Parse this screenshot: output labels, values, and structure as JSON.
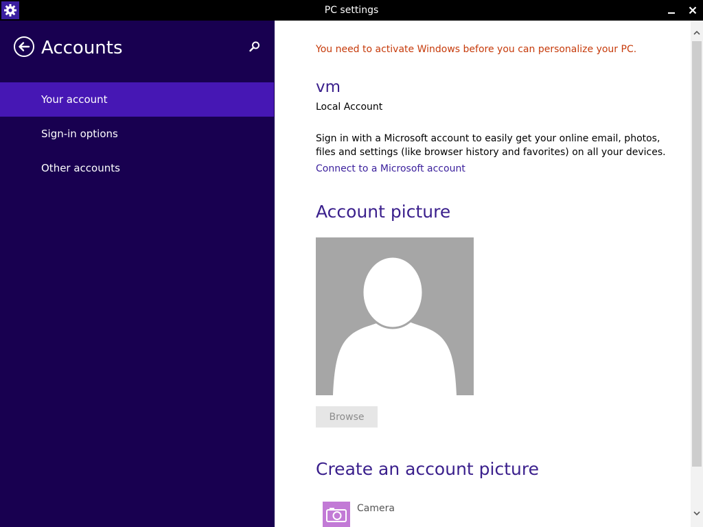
{
  "window": {
    "title": "PC settings"
  },
  "sidebar": {
    "title": "Accounts",
    "items": [
      {
        "label": "Your account",
        "selected": true
      },
      {
        "label": "Sign-in options",
        "selected": false
      },
      {
        "label": "Other accounts",
        "selected": false
      }
    ]
  },
  "main": {
    "activation_message": "You need to activate Windows before you can personalize your PC.",
    "user_name": "vm",
    "account_type": "Local Account",
    "ms_description": "Sign in with a Microsoft account to easily get your online email, photos, files and settings (like browser history and favorites) on all your devices.",
    "ms_link": "Connect to a Microsoft account",
    "picture_heading": "Account picture",
    "browse_label": "Browse",
    "create_heading": "Create an account picture",
    "camera_label": "Camera"
  },
  "colors": {
    "sidebar_bg": "#180050",
    "sidebar_selected": "#4617b4",
    "accent_text": "#3a1f8c",
    "warning_text": "#c63a0a"
  },
  "icons": {
    "app": "gear-icon",
    "back": "back-arrow-icon",
    "search": "search-icon",
    "minimize": "minimize-icon",
    "close": "close-icon",
    "camera": "camera-icon"
  }
}
